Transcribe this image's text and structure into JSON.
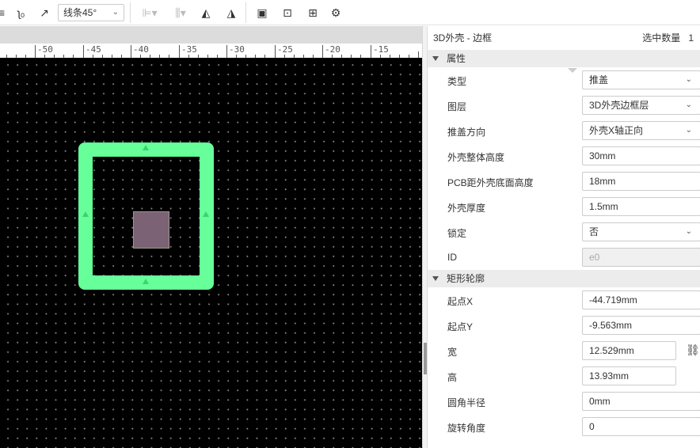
{
  "toolbar": {
    "line_mode": "线条45°"
  },
  "ruler": {
    "labels": [
      "-50",
      "-45",
      "-40",
      "-35",
      "-30",
      "-25",
      "-20",
      "-15"
    ]
  },
  "panel": {
    "title": "3D外壳 - 边框",
    "selected_label": "选中数量",
    "selected_count": "1",
    "sections": [
      {
        "label": "属性"
      },
      {
        "label": "矩形轮廓"
      }
    ],
    "props": [
      {
        "label": "类型",
        "value": "推盖"
      },
      {
        "label": "图层",
        "value": "3D外壳边框层"
      },
      {
        "label": "推盖方向",
        "value": "外壳X轴正向"
      },
      {
        "label": "外壳整体高度",
        "value": "30mm"
      },
      {
        "label": "PCB距外壳底面高度",
        "value": "18mm"
      },
      {
        "label": "外壳厚度",
        "value": "1.5mm"
      },
      {
        "label": "锁定",
        "value": "否"
      },
      {
        "label": "ID",
        "value": "e0"
      }
    ],
    "rect": [
      {
        "label": "起点X",
        "value": "-44.719mm"
      },
      {
        "label": "起点Y",
        "value": "-9.563mm"
      },
      {
        "label": "宽",
        "value": "12.529mm"
      },
      {
        "label": "高",
        "value": "13.93mm"
      },
      {
        "label": "圆角半径",
        "value": "0mm"
      },
      {
        "label": "旋转角度",
        "value": "0"
      }
    ]
  },
  "colors": {
    "frame": "#66ff99",
    "canvas": "#000000"
  }
}
